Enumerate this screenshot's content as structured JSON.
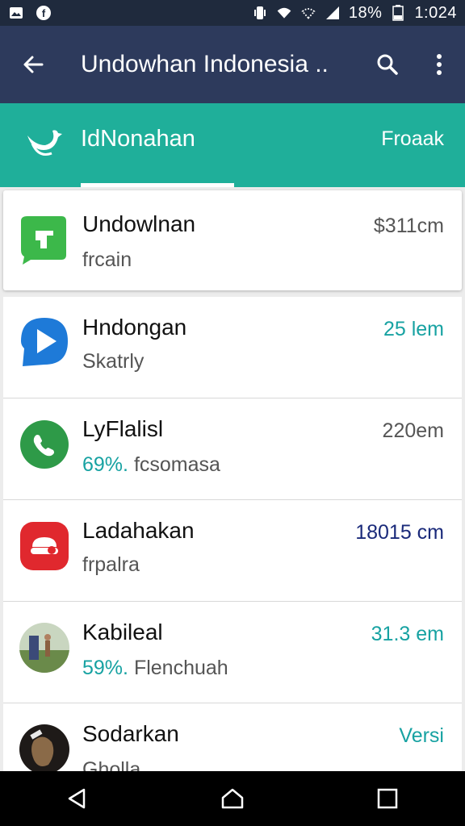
{
  "status_bar": {
    "battery": "18%",
    "time": "1:024",
    "icons": [
      "photo-notification-icon",
      "facebook-notification-icon",
      "vibrate-icon",
      "wifi-icon",
      "wifi-alt-icon",
      "cell-signal-icon",
      "battery-icon"
    ]
  },
  "toolbar": {
    "title": "Undowhan Indonesia ..",
    "icons": [
      "back-arrow-icon",
      "search-icon",
      "more-vert-icon"
    ]
  },
  "tabs": {
    "primary_label": "IdNonahan",
    "secondary_label": "Froaak",
    "indicator_color": "#ffffff",
    "bar_color": "#1faf9a"
  },
  "apps": [
    {
      "name": "Undowlnan",
      "sub": "frcain",
      "sub_pct": "",
      "size": "$311cm",
      "size_color": "#555555",
      "icon": "green-chat-icon",
      "icon_color": "#3cb84a"
    },
    {
      "name": "Hndongan",
      "sub": "Skatrly",
      "sub_pct": "",
      "size": "25 lem",
      "size_color": "#17a2a2",
      "icon": "blue-play-icon",
      "icon_color": "#1e7ad8"
    },
    {
      "name": "LyFlalisl",
      "sub": "fcsomasa",
      "sub_pct": "69%.",
      "size": "220em",
      "size_color": "#555555",
      "icon": "phone-icon",
      "icon_color": "#2e9a48"
    },
    {
      "name": "Ladahakan",
      "sub": "frpalra",
      "sub_pct": "",
      "size": "18015 cm",
      "size_color": "#1a2a7a",
      "icon": "red-badge-icon",
      "icon_color": "#e0282e"
    },
    {
      "name": "Kabileal",
      "sub": "Flenchuah",
      "sub_pct": "59%.",
      "size": "31.3 em",
      "size_color": "#17a2a2",
      "icon": "sports-photo-icon",
      "icon_color": "#6a8a4a"
    },
    {
      "name": "Sodarkan",
      "sub": "Gholla",
      "sub_pct": "",
      "size": "Versi",
      "size_color": "#17a2a2",
      "icon": "figure-photo-icon",
      "icon_color": "#3a2e26"
    }
  ],
  "nav_bar": {
    "icons": [
      "nav-back-icon",
      "nav-home-icon",
      "nav-recents-icon"
    ]
  }
}
